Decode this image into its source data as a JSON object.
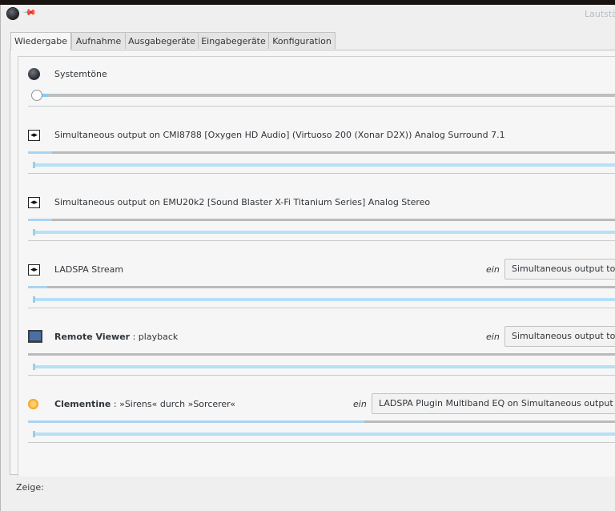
{
  "window": {
    "title": "Lautstä"
  },
  "tabs": [
    {
      "label": "Wiedergabe",
      "active": true
    },
    {
      "label": "Aufnahme",
      "active": false
    },
    {
      "label": "Ausgabegeräte",
      "active": false
    },
    {
      "label": "Eingabegeräte",
      "active": false
    },
    {
      "label": "Konfiguration",
      "active": false
    }
  ],
  "system": {
    "label": "Systemtöne",
    "icon": "system-sound-icon",
    "volume_fraction": 0.03
  },
  "streams": [
    {
      "label": "Simultaneous output on CMI8788 [Oxygen HD Audio] (Virtuoso 200 (Xonar D2X)) Analog Surround 7.1",
      "icon": "audio-device-icon",
      "level_fraction": 0.04
    },
    {
      "label": "Simultaneous output on EMU20k2 [Sound Blaster X-Fi Titanium Series] Analog Stereo",
      "icon": "audio-device-icon",
      "level_fraction": 0.04
    },
    {
      "label": "LADSPA Stream",
      "icon": "audio-device-icon",
      "on_label": "ein",
      "device": "Simultaneous output to CM",
      "level_fraction": 0.03
    },
    {
      "name": "Remote Viewer",
      "detail": ": playback",
      "icon": "monitor-icon",
      "on_label": "ein",
      "device": "Simultaneous output to CM",
      "level_fraction": 0.0
    },
    {
      "name": "Clementine",
      "detail": ": »Sirens« durch »Sorcerer«",
      "icon": "clementine-icon",
      "on_label": "ein",
      "device": "LADSPA Plugin Multiband EQ on Simultaneous output to CM",
      "level_fraction": 0.55
    }
  ],
  "footer": {
    "show_label": "Zeige:"
  },
  "colors": {
    "accent": "#a9d4f0",
    "slider": "#b5e0f6",
    "background": "#efefef"
  }
}
